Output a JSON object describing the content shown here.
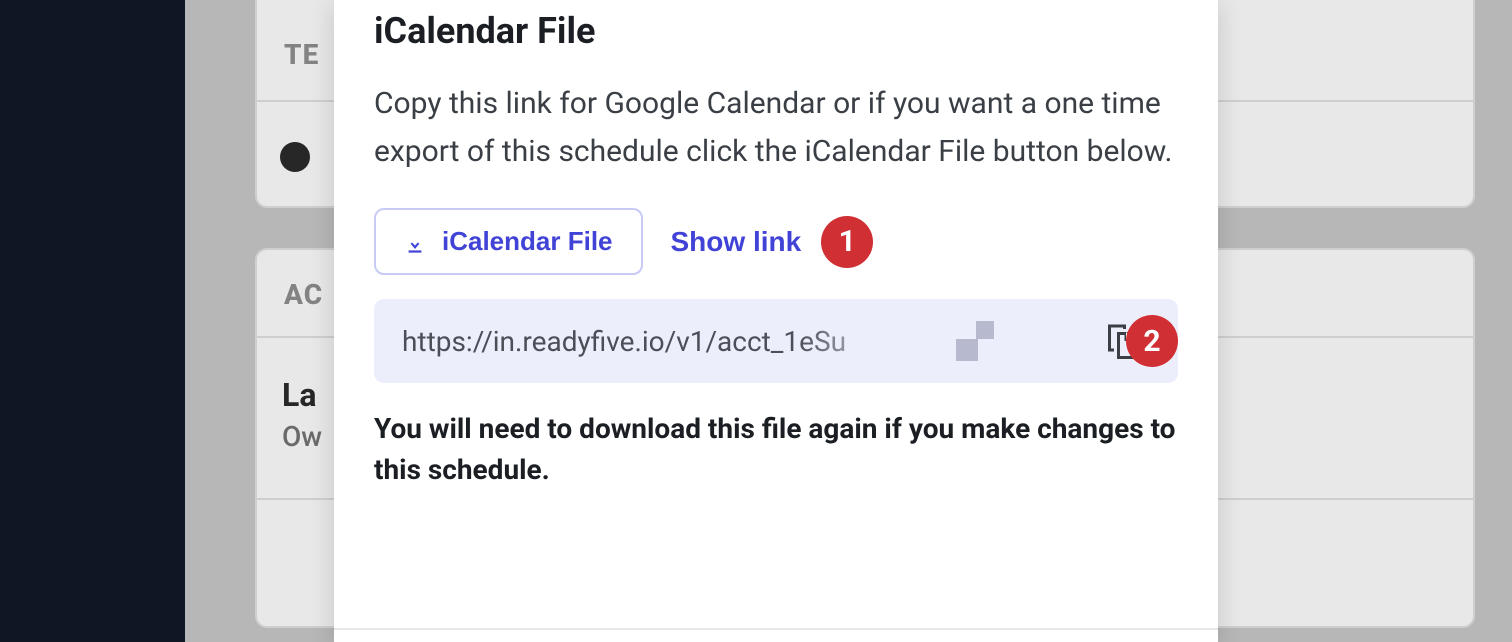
{
  "modal": {
    "title": "iCalendar File",
    "description": "Copy this link for Google Calendar or if you want a one time export of this schedule click the iCalendar File button below.",
    "download_button_label": "iCalendar File",
    "show_link_label": "Show link",
    "url_value": "https://in.readyfive.io/v1/acct_1eSu",
    "note": "You will need to download this file again if you make changes to this schedule.",
    "badge_1": "1",
    "badge_2": "2"
  },
  "background": {
    "section_team_label": "TE",
    "section_actions_label": "AC",
    "row_name_partial": "La",
    "row_role_partial": "Ow"
  },
  "icons": {
    "download": "download-icon",
    "copy": "copy-icon"
  },
  "colors": {
    "accent": "#4143d6",
    "badge": "#d02f33",
    "url_bg": "#eceefc"
  }
}
